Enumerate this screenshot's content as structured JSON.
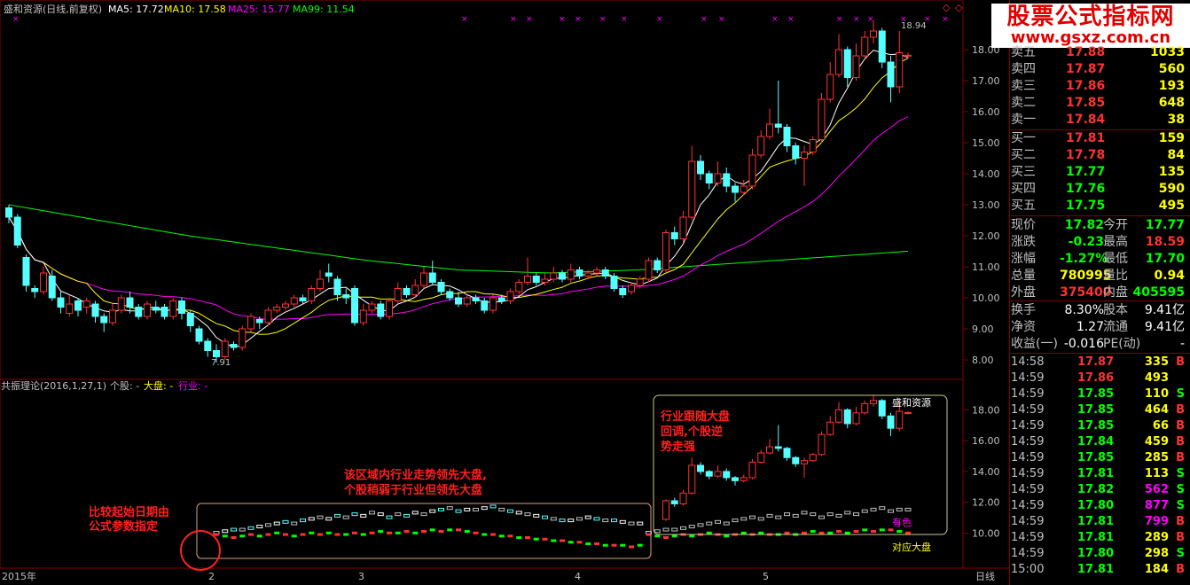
{
  "header": {
    "stock": "盛和资源(日线,前复权)",
    "ma5": "MA5: 17.72",
    "ma10": "MA10: 17.58",
    "ma25": "MA25: 15.77",
    "ma99": "MA99: 11.54"
  },
  "subheader": {
    "indicator": "共振理论(2016,1,27,1)",
    "stock_lbl": "个股: -",
    "market_lbl": "大盘: -",
    "industry_lbl": "行业: -"
  },
  "logo": {
    "line1": "股票公式指标网",
    "line2": "www.gsxz.com.cn"
  },
  "annotations": {
    "note1a": "比较起始日期由",
    "note1b": "公式参数指定",
    "note2a": "该区域内行业走势领先大盘,",
    "note2b": "个股稍弱于行业但领先大盘",
    "note3a": "行业跟随大盘",
    "note3b": "回调,个股逆",
    "note3c": "势走强",
    "lbl_stock": "盛和资源",
    "lbl_industry": "有色",
    "lbl_market": "对应大盘"
  },
  "markers": {
    "high": "18.94",
    "low": "7.91"
  },
  "colors": {
    "up": "#ff3232",
    "down": "#54ffff",
    "ma5": "#ffffff",
    "ma10": "#ffff00",
    "ma25": "#ff00ff",
    "ma99": "#00ff00",
    "grid": "#800000"
  },
  "orderbook": [
    {
      "label": "卖五",
      "price": "17.88",
      "vol": "1033",
      "pc": "#ff3232"
    },
    {
      "label": "卖四",
      "price": "17.87",
      "vol": "560",
      "pc": "#ff3232"
    },
    {
      "label": "卖三",
      "price": "17.86",
      "vol": "193",
      "pc": "#ff3232"
    },
    {
      "label": "卖二",
      "price": "17.85",
      "vol": "648",
      "pc": "#ff3232"
    },
    {
      "label": "卖一",
      "price": "17.84",
      "vol": "38",
      "pc": "#ff3232"
    },
    {
      "label": "买一",
      "price": "17.81",
      "vol": "159",
      "pc": "#ff3232"
    },
    {
      "label": "买二",
      "price": "17.78",
      "vol": "84",
      "pc": "#ff3232"
    },
    {
      "label": "买三",
      "price": "17.77",
      "vol": "135",
      "pc": "#00ff00"
    },
    {
      "label": "买四",
      "price": "17.76",
      "vol": "590",
      "pc": "#00ff00"
    },
    {
      "label": "买五",
      "price": "17.75",
      "vol": "495",
      "pc": "#00ff00"
    }
  ],
  "quote": [
    {
      "l1": "现价",
      "v1": "17.82",
      "c1": "#00ff00",
      "l2": "今开",
      "v2": "17.77",
      "c2": "#00ff00"
    },
    {
      "l1": "涨跌",
      "v1": "-0.23",
      "c1": "#00ff00",
      "l2": "最高",
      "v2": "18.59",
      "c2": "#ff3232"
    },
    {
      "l1": "涨幅",
      "v1": "-1.27%",
      "c1": "#00ff00",
      "l2": "最低",
      "v2": "17.70",
      "c2": "#00ff00"
    },
    {
      "l1": "总量",
      "v1": "780995",
      "c1": "#ffff00",
      "l2": "量比",
      "v2": "0.94",
      "c2": "#ffff00"
    },
    {
      "l1": "外盘",
      "v1": "375400",
      "c1": "#ff3232",
      "l2": "内盘",
      "v2": "405595",
      "c2": "#00ff00"
    }
  ],
  "stats": [
    {
      "l1": "换手",
      "v1": "8.30%",
      "l2": "股本",
      "v2": "9.41亿"
    },
    {
      "l1": "净资",
      "v1": "1.27",
      "l2": "流通",
      "v2": "9.41亿"
    },
    {
      "l1": "收益(一)",
      "v1": "-0.016",
      "l2": "PE(动)",
      "v2": "-"
    }
  ],
  "ticks": [
    {
      "t": "14:58",
      "p": "17.87",
      "pc": "#ff3232",
      "v": "335",
      "vc": "#ffff00",
      "s": "B",
      "sc": "#ff3232"
    },
    {
      "t": "14:59",
      "p": "17.86",
      "pc": "#ff3232",
      "v": "493",
      "vc": "#ffff00",
      "s": "",
      "sc": "#ff3232"
    },
    {
      "t": "14:59",
      "p": "17.85",
      "pc": "#00ff00",
      "v": "110",
      "vc": "#ffff00",
      "s": "S",
      "sc": "#00ff00"
    },
    {
      "t": "14:59",
      "p": "17.85",
      "pc": "#00ff00",
      "v": "464",
      "vc": "#ffff00",
      "s": "B",
      "sc": "#ff3232"
    },
    {
      "t": "14:59",
      "p": "17.85",
      "pc": "#00ff00",
      "v": "66",
      "vc": "#ffff00",
      "s": "B",
      "sc": "#ff3232"
    },
    {
      "t": "14:59",
      "p": "17.84",
      "pc": "#00ff00",
      "v": "459",
      "vc": "#ffff00",
      "s": "B",
      "sc": "#ff3232"
    },
    {
      "t": "14:59",
      "p": "17.85",
      "pc": "#00ff00",
      "v": "285",
      "vc": "#ffff00",
      "s": "B",
      "sc": "#ff3232"
    },
    {
      "t": "14:59",
      "p": "17.81",
      "pc": "#00ff00",
      "v": "113",
      "vc": "#ffff00",
      "s": "S",
      "sc": "#00ff00"
    },
    {
      "t": "14:59",
      "p": "17.82",
      "pc": "#00ff00",
      "v": "562",
      "vc": "#ff00ff",
      "s": "S",
      "sc": "#00ff00"
    },
    {
      "t": "14:59",
      "p": "17.80",
      "pc": "#00ff00",
      "v": "877",
      "vc": "#ff00ff",
      "s": "S",
      "sc": "#00ff00"
    },
    {
      "t": "14:59",
      "p": "17.81",
      "pc": "#00ff00",
      "v": "799",
      "vc": "#ff00ff",
      "s": "B",
      "sc": "#ff3232"
    },
    {
      "t": "14:59",
      "p": "17.81",
      "pc": "#00ff00",
      "v": "289",
      "vc": "#ffff00",
      "s": "B",
      "sc": "#ff3232"
    },
    {
      "t": "14:59",
      "p": "17.80",
      "pc": "#00ff00",
      "v": "298",
      "vc": "#ffff00",
      "s": "S",
      "sc": "#00ff00"
    },
    {
      "t": "15:00",
      "p": "17.81",
      "pc": "#00ff00",
      "v": "184",
      "vc": "#ffff00",
      "s": "B",
      "sc": "#ff3232"
    }
  ],
  "period_label": "日线",
  "chart_data": {
    "type": "candlestick",
    "ylim": [
      7.6,
      19.2
    ],
    "yticks_main": [
      "18.00",
      "17.00",
      "16.00",
      "15.00",
      "14.00",
      "13.00",
      "12.00",
      "11.00",
      "10.00",
      "9.00",
      "8.00"
    ],
    "yticks_sub": [
      "18.00",
      "16.00",
      "14.00",
      "12.00",
      "10.00"
    ],
    "xlabels": [
      "2015年",
      "2",
      "3",
      "4",
      "5"
    ],
    "candles": [
      [
        12.9,
        12.6,
        13.0,
        12.4
      ],
      [
        12.6,
        11.7,
        12.7,
        11.6
      ],
      [
        11.3,
        10.4,
        11.4,
        10.2
      ],
      [
        10.3,
        10.2,
        10.4,
        10.0
      ],
      [
        10.2,
        10.8,
        11.0,
        10.1
      ],
      [
        10.7,
        10.0,
        10.9,
        9.9
      ],
      [
        10.0,
        9.7,
        10.2,
        9.5
      ],
      [
        9.5,
        9.8,
        10.1,
        9.4
      ],
      [
        9.9,
        9.6,
        10.0,
        9.4
      ],
      [
        9.7,
        9.9,
        10.0,
        9.5
      ],
      [
        9.8,
        9.4,
        9.9,
        9.2
      ],
      [
        9.4,
        9.2,
        9.5,
        8.9
      ],
      [
        9.2,
        9.6,
        9.8,
        9.1
      ],
      [
        9.6,
        10.0,
        10.1,
        9.5
      ],
      [
        10.0,
        9.7,
        10.2,
        9.5
      ],
      [
        9.7,
        9.4,
        9.8,
        9.3
      ],
      [
        9.4,
        9.8,
        9.9,
        9.3
      ],
      [
        9.7,
        9.6,
        9.9,
        9.5
      ],
      [
        9.7,
        9.4,
        9.8,
        9.3
      ],
      [
        9.4,
        9.9,
        10.0,
        9.3
      ],
      [
        9.9,
        9.5,
        10.0,
        9.3
      ],
      [
        9.5,
        9.1,
        9.6,
        8.9
      ],
      [
        9.0,
        8.6,
        9.1,
        8.5
      ],
      [
        8.6,
        8.3,
        8.7,
        8.1
      ],
      [
        8.3,
        8.1,
        8.5,
        7.91
      ],
      [
        8.1,
        8.6,
        8.7,
        8.0
      ],
      [
        8.5,
        8.4,
        8.6,
        8.3
      ],
      [
        8.4,
        9.0,
        9.1,
        8.3
      ],
      [
        9.0,
        9.4,
        9.5,
        8.9
      ],
      [
        9.3,
        9.2,
        9.4,
        9.0
      ],
      [
        9.2,
        9.6,
        9.7,
        9.1
      ],
      [
        9.6,
        9.7,
        9.8,
        9.5
      ],
      [
        9.7,
        9.8,
        9.9,
        9.6
      ],
      [
        9.8,
        10.0,
        10.1,
        9.7
      ],
      [
        10.0,
        9.9,
        10.1,
        9.8
      ],
      [
        9.9,
        10.3,
        10.4,
        9.8
      ],
      [
        10.3,
        10.6,
        10.9,
        10.2
      ],
      [
        10.8,
        10.7,
        11.1,
        10.5
      ],
      [
        10.6,
        10.1,
        10.7,
        9.9
      ],
      [
        10.1,
        10.0,
        10.3,
        9.8
      ],
      [
        10.3,
        9.2,
        10.4,
        9.1
      ],
      [
        9.2,
        9.6,
        9.8,
        9.1
      ],
      [
        9.6,
        9.8,
        9.9,
        9.5
      ],
      [
        9.8,
        9.4,
        9.9,
        9.3
      ],
      [
        9.4,
        9.9,
        10.0,
        9.3
      ],
      [
        9.9,
        10.3,
        10.5,
        9.8
      ],
      [
        10.3,
        10.1,
        10.4,
        10.0
      ],
      [
        10.1,
        10.4,
        10.6,
        10.0
      ],
      [
        10.4,
        10.8,
        11.0,
        10.3
      ],
      [
        10.8,
        10.5,
        11.2,
        10.4
      ],
      [
        10.5,
        10.2,
        10.6,
        10.1
      ],
      [
        10.2,
        10.0,
        10.3,
        9.9
      ],
      [
        10.0,
        9.8,
        10.2,
        9.7
      ],
      [
        9.8,
        10.0,
        10.1,
        9.7
      ],
      [
        10.0,
        9.9,
        10.1,
        9.8
      ],
      [
        9.9,
        9.6,
        10.0,
        9.5
      ],
      [
        9.6,
        10.0,
        10.1,
        9.5
      ],
      [
        10.0,
        9.9,
        10.1,
        9.8
      ],
      [
        9.9,
        10.2,
        10.3,
        9.8
      ],
      [
        10.2,
        10.5,
        10.6,
        10.1
      ],
      [
        10.5,
        10.7,
        11.3,
        10.4
      ],
      [
        10.7,
        10.5,
        10.8,
        10.4
      ],
      [
        10.5,
        10.6,
        10.8,
        10.4
      ],
      [
        10.6,
        10.8,
        11.0,
        10.5
      ],
      [
        10.8,
        10.6,
        10.9,
        10.5
      ],
      [
        10.6,
        10.9,
        11.1,
        10.5
      ],
      [
        10.9,
        10.7,
        11.0,
        10.6
      ],
      [
        10.7,
        10.8,
        10.9,
        10.6
      ],
      [
        10.8,
        10.9,
        11.0,
        10.7
      ],
      [
        10.9,
        10.7,
        11.0,
        10.6
      ],
      [
        10.7,
        10.3,
        10.8,
        10.2
      ],
      [
        10.3,
        10.1,
        10.4,
        10.0
      ],
      [
        10.2,
        10.4,
        10.5,
        10.1
      ],
      [
        10.4,
        10.6,
        10.7,
        10.3
      ],
      [
        10.6,
        11.2,
        11.3,
        10.5
      ],
      [
        11.2,
        10.9,
        11.3,
        10.8
      ],
      [
        10.9,
        12.1,
        12.2,
        10.8
      ],
      [
        12.1,
        11.9,
        12.3,
        11.7
      ],
      [
        11.9,
        12.6,
        12.8,
        11.8
      ],
      [
        12.6,
        14.4,
        14.9,
        12.5
      ],
      [
        14.4,
        14.0,
        14.6,
        13.8
      ],
      [
        14.0,
        13.7,
        14.1,
        13.5
      ],
      [
        13.7,
        14.0,
        14.4,
        13.6
      ],
      [
        14.0,
        13.6,
        14.2,
        13.4
      ],
      [
        13.6,
        13.4,
        13.7,
        13.1
      ],
      [
        13.4,
        13.6,
        13.8,
        13.3
      ],
      [
        13.6,
        14.6,
        14.8,
        13.5
      ],
      [
        14.6,
        15.2,
        15.4,
        14.5
      ],
      [
        15.2,
        15.6,
        16.1,
        15.1
      ],
      [
        15.6,
        15.5,
        17.0,
        15.3
      ],
      [
        15.5,
        14.9,
        15.6,
        14.7
      ],
      [
        14.9,
        14.5,
        15.0,
        14.3
      ],
      [
        14.5,
        14.7,
        14.9,
        13.6
      ],
      [
        14.7,
        15.1,
        15.2,
        14.6
      ],
      [
        15.1,
        16.4,
        16.6,
        15.0
      ],
      [
        16.4,
        17.2,
        17.6,
        16.3
      ],
      [
        17.2,
        18.0,
        18.5,
        17.1
      ],
      [
        18.0,
        17.1,
        18.1,
        16.8
      ],
      [
        17.1,
        17.8,
        18.2,
        17.0
      ],
      [
        17.8,
        18.4,
        18.6,
        17.7
      ],
      [
        18.4,
        18.6,
        18.94,
        18.2
      ],
      [
        18.6,
        17.6,
        18.7,
        17.4
      ],
      [
        17.6,
        16.8,
        17.8,
        16.3
      ],
      [
        16.8,
        17.9,
        18.6,
        16.6
      ],
      [
        17.82,
        17.82,
        17.9,
        17.7
      ]
    ],
    "industry": [
      10.0,
      10.1,
      10.2,
      10.2,
      10.3,
      10.4,
      10.5,
      10.6,
      10.7,
      10.6,
      10.8,
      10.9,
      11.0,
      10.9,
      11.1,
      11.0,
      11.2,
      11.1,
      11.3,
      11.2,
      11.0,
      11.2,
      11.1,
      11.3,
      11.2,
      11.4,
      11.5,
      11.6,
      11.4,
      11.5,
      11.5,
      11.6,
      11.7,
      11.5,
      11.4,
      11.3,
      11.2,
      11.1,
      11.0,
      10.9,
      10.8,
      10.8,
      10.9,
      11.0,
      10.9,
      10.8,
      10.8,
      10.7,
      10.6,
      10.6
    ],
    "market": [
      10.0,
      9.9,
      9.8,
      9.9,
      10.0,
      9.9,
      10.0,
      10.1,
      10.0,
      9.9,
      10.0,
      10.1,
      10.0,
      10.1,
      10.0,
      10.0,
      10.1,
      10.0,
      10.1,
      10.2,
      10.1,
      10.1,
      10.2,
      10.1,
      10.2,
      10.3,
      10.2,
      10.3,
      10.3,
      10.2,
      10.1,
      10.0,
      10.0,
      9.9,
      9.9,
      9.8,
      9.8,
      9.7,
      9.7,
      9.6,
      9.6,
      9.5,
      9.5,
      9.4,
      9.4,
      9.3,
      9.3,
      9.3,
      9.2,
      9.3
    ]
  }
}
